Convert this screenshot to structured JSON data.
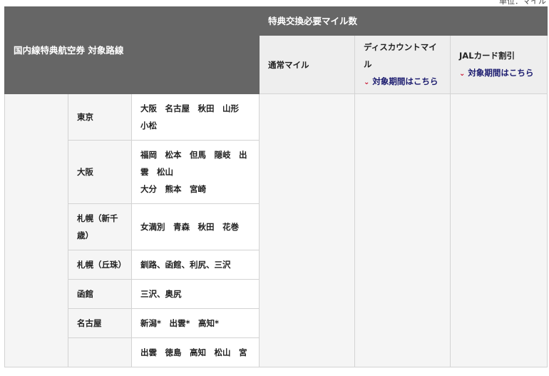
{
  "unit_note": "単位：マイル",
  "header": {
    "route_title": "国内線特典航空券 対象路線",
    "required_title": "特典交換必要マイル数",
    "col_normal": "通常マイル",
    "col_discount": "ディスカウントマイル",
    "col_jal": "JALカード割引",
    "period_link": "対象期間はこちら"
  },
  "rows": [
    {
      "origin": "東京",
      "dests": [
        "大阪　名古屋　秋田　山形",
        "小松"
      ]
    },
    {
      "origin": "大阪",
      "dests": [
        "福岡　松本　但馬　隠岐　出",
        "雲　松山",
        "大分　熊本　宮崎"
      ]
    },
    {
      "origin": "札幌（新千歳）",
      "dests": [
        "女満別　青森　秋田　花巻"
      ]
    },
    {
      "origin": "札幌（丘珠）",
      "dests": [
        "釧路、函館、利尻、三沢"
      ]
    },
    {
      "origin": "函館",
      "dests": [
        "三沢、奥尻"
      ]
    },
    {
      "origin": "名古屋",
      "dests": [
        "新潟*　出雲*　高知*"
      ]
    },
    {
      "origin": "",
      "dests": [
        "出雲　徳島　高知　松山　宮"
      ]
    }
  ]
}
